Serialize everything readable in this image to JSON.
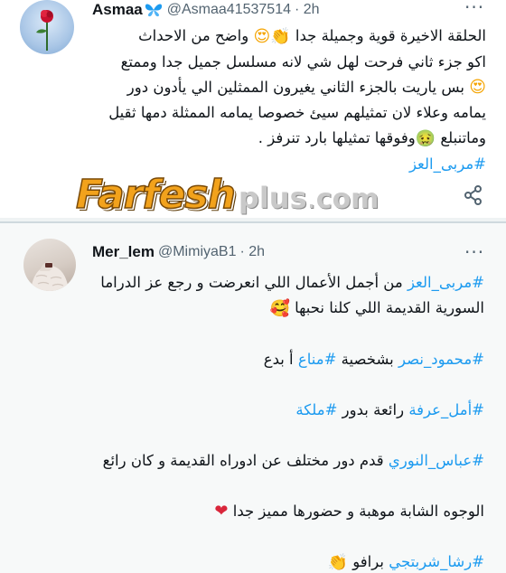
{
  "tweet1": {
    "name": "Asmaa",
    "handle": "@Asmaa41537514",
    "time": "· 2h",
    "lines": [
      {
        "text": "الحلقة الاخيرة قوية وجميلة جدا ",
        "emoji_after": [
          "clap",
          "heart-eyes"
        ],
        "trail": " واضح من الاحداث"
      },
      {
        "text": "اكو جزء ثاني فرحت لهل شي لانه مسلسل جميل جدا وممتع"
      },
      {
        "emoji_before": "heart-eyes",
        "text": " بس ياريت بالجزء الثاني يغيرون الممثلين الي يأدون دور"
      },
      {
        "text": "يمامه وعلاء لان تمثيلهم سيئ خصوصا يمامه الممثلة دمها ثقيل"
      },
      {
        "text": "وماتنبلع ",
        "emoji": "sick",
        "trail": "وفوقها تمثيلها بارد تنرفز ."
      }
    ],
    "hashtag": "#مربى_العز"
  },
  "watermark": {
    "main": "Farfesh",
    "plus": "plus",
    "dot": ".",
    "com": "com"
  },
  "tweet2": {
    "name": "Mer_lem",
    "handle": "@MimiyaB1",
    "time": "· 2h",
    "paragraphs": [
      {
        "hashtag": "#مربى_العز",
        "text": " من أجمل الأعمال اللي انعرضت  و رجع عز الدراما"
      },
      {
        "text": "السورية القديمة اللي كلنا نحبها ",
        "emoji": "love"
      },
      {
        "hashtag": "#محمود_نصر",
        "text": " بشخصية ",
        "hashtag2": "#مناع",
        "trail": " أ بدع"
      },
      {
        "hashtag": "#أمل_عرفة",
        "text": "  رائعة بدور ",
        "hashtag2": "#ملكة"
      },
      {
        "hashtag": "#عباس_النوري",
        "text": " قدم دور مختلف عن ادوراه القديمة و كان رائع"
      },
      {
        "text": "الوجوه الشابة موهبة و  حضورها مميز جدا ",
        "emoji": "heart"
      },
      {
        "hashtag": "#رشا_شربتجي",
        "text": " برافو ",
        "emoji": "clap"
      }
    ]
  },
  "icons": {
    "badge": "butterfly-icon",
    "more": "more-icon",
    "share": "share-icon"
  },
  "colors": {
    "hashtag": "#1d9bf0",
    "handle": "#536471",
    "watermark": "#f2a21c"
  }
}
